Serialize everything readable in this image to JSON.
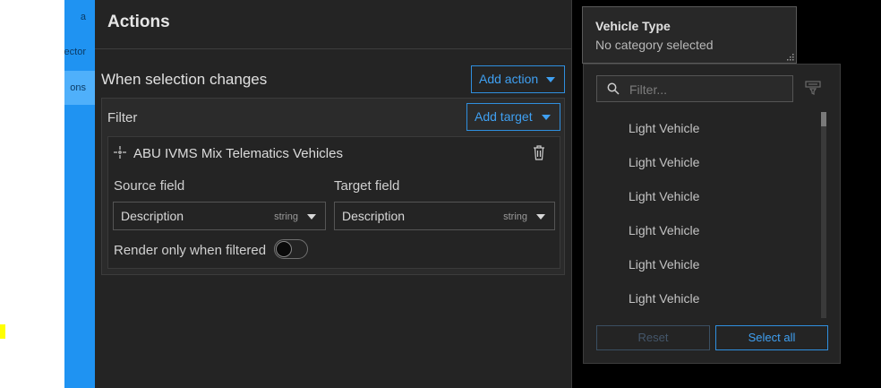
{
  "left_sidebar": {
    "items": [
      {
        "label": "a"
      },
      {
        "label": "ector"
      },
      {
        "label": "ons"
      }
    ]
  },
  "settings": {
    "title": "Actions",
    "selection_changes_label": "When selection changes",
    "add_action_label": "Add action",
    "filter": {
      "label": "Filter",
      "add_target_label": "Add target",
      "target": {
        "name": "ABU IVMS Mix Telematics Vehicles",
        "source_field_label": "Source field",
        "target_field_label": "Target field",
        "source_value": "Description",
        "source_type": "string",
        "target_value": "Description",
        "target_type": "string",
        "render_label": "Render only when filtered",
        "render_toggle_on": false
      }
    }
  },
  "vehicle_type": {
    "title": "Vehicle Type",
    "subtitle": "No category selected",
    "search_placeholder": "Filter...",
    "items": [
      {
        "label": "Light Vehicle"
      },
      {
        "label": "Light Vehicle"
      },
      {
        "label": "Light Vehicle"
      },
      {
        "label": "Light Vehicle"
      },
      {
        "label": "Light Vehicle"
      },
      {
        "label": "Light Vehicle"
      }
    ],
    "reset_label": "Reset",
    "select_all_label": "Select all"
  },
  "colors": {
    "accent": "#2f8fdf",
    "sidebar_blue": "#1f93f2",
    "panel_bg": "#242424",
    "marker_yellow": "#ffff00"
  },
  "icons": {
    "target": "crosshair-icon",
    "delete": "trash-icon",
    "search": "search-icon",
    "filter": "filter-icon",
    "resize": "resize-grip-icon"
  }
}
